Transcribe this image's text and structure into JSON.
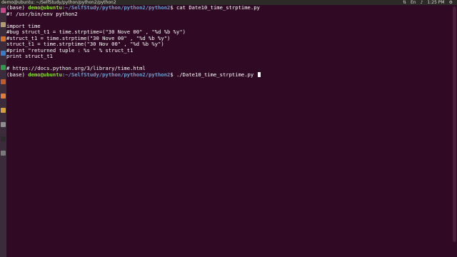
{
  "topbar": {
    "window_title": "demo@ubuntu: ~/SelfStudy/python/python2/python2",
    "time": "1:25 PM"
  },
  "launcher": {
    "icons": [
      {
        "name": "dash-icon",
        "color": "#c9478d"
      },
      {
        "name": "files-icon",
        "color": "#b49d73"
      },
      {
        "name": "firefox-icon",
        "color": "#d46f2a"
      },
      {
        "name": "writer-icon",
        "color": "#3b7bc8"
      },
      {
        "name": "calc-icon",
        "color": "#2e9a4a"
      },
      {
        "name": "impress-icon",
        "color": "#c25a2c"
      },
      {
        "name": "software-icon",
        "color": "#e07b39"
      },
      {
        "name": "amazon-icon",
        "color": "#d9a039"
      },
      {
        "name": "settings-icon",
        "color": "#8f8f8f"
      },
      {
        "name": "terminal-icon",
        "color": "#2b2b2b"
      },
      {
        "name": "trash-icon",
        "color": "#7a7a7a"
      }
    ]
  },
  "terminal": {
    "lines": [
      {
        "type": "prompt",
        "env": "(base) ",
        "user": "demo@ubuntu",
        "path": ":~/SelfStudy/python/python2/python2",
        "cmd": "$ cat Date10_time_strptime.py"
      },
      {
        "type": "text",
        "text": "#! /usr/bin/env python2"
      },
      {
        "type": "text",
        "text": ""
      },
      {
        "type": "text",
        "text": "import time"
      },
      {
        "type": "text",
        "text": "#bug struct_t1 = time.strptime=(\"30 Nove 00\" , \"%d %b %y\")"
      },
      {
        "type": "text",
        "text": "#struct_t1 = time.strptime(\"30 Nove 00\" , \"%d %b %y\")"
      },
      {
        "type": "text",
        "text": "struct_t1 = time.strptime(\"30 Nov 00\" , \"%d %b %y\")"
      },
      {
        "type": "text",
        "text": "#print \"returned tuple : %s \" % struct_t1"
      },
      {
        "type": "text",
        "text": "print struct_t1"
      },
      {
        "type": "text",
        "text": ""
      },
      {
        "type": "text",
        "text": "# https://docs.python.org/3/library/time.html"
      },
      {
        "type": "prompt",
        "env": "(base) ",
        "user": "demo@ubuntu",
        "path": ":~/SelfStudy/python/python2/python2",
        "cmd": "$ ./Date10_time_strptime.py ",
        "cursor": true
      }
    ]
  },
  "colors": {
    "terminal_bg": "#300a24",
    "prompt_user": "#8ae234",
    "prompt_path": "#729fcf",
    "text": "#ffffff"
  }
}
